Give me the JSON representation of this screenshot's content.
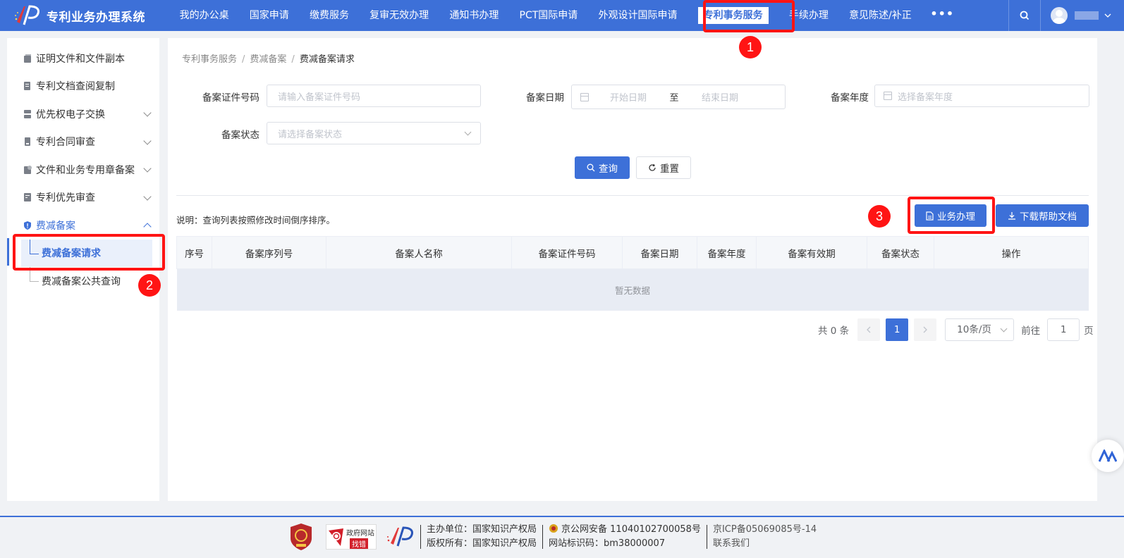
{
  "app": {
    "title": "专利业务办理系统"
  },
  "nav": {
    "items": [
      {
        "label": "我的办公桌"
      },
      {
        "label": "国家申请"
      },
      {
        "label": "缴费服务"
      },
      {
        "label": "复审无效办理"
      },
      {
        "label": "通知书办理"
      },
      {
        "label": "PCT国际申请"
      },
      {
        "label": "外观设计国际申请"
      },
      {
        "label": "专利事务服务",
        "active": true
      },
      {
        "label": "手续办理"
      },
      {
        "label": "意见陈述/补正"
      }
    ],
    "more": "•••"
  },
  "sidebar": {
    "items": [
      {
        "label": "证明文件和文件副本",
        "icon": "document-stack-icon"
      },
      {
        "label": "专利文档查阅复制",
        "icon": "document-copy-icon"
      },
      {
        "label": "优先权电子交换",
        "icon": "server-icon"
      },
      {
        "label": "专利合同审查",
        "icon": "contract-icon"
      },
      {
        "label": "文件和业务专用章备案",
        "icon": "seal-document-icon"
      },
      {
        "label": "专利优先审查",
        "icon": "priority-icon"
      },
      {
        "label": "费减备案",
        "icon": "shield-icon"
      }
    ],
    "subitems": [
      {
        "label": "费减备案请求",
        "active": true
      },
      {
        "label": "费减备案公共查询"
      }
    ]
  },
  "breadcrumb": {
    "l1": "专利事务服务",
    "l2": "费减备案",
    "l3": "费减备案请求",
    "sep": "/"
  },
  "form": {
    "cert_label": "备案证件号码",
    "cert_placeholder": "请输入备案证件号码",
    "date_label": "备案日期",
    "date_start": "开始日期",
    "date_to": "至",
    "date_end": "结束日期",
    "year_label": "备案年度",
    "year_placeholder": "选择备案年度",
    "status_label": "备案状态",
    "status_placeholder": "请选择备案状态",
    "query_btn": "查询",
    "reset_btn": "重置"
  },
  "note": "说明：查询列表按照修改时间倒序排序。",
  "actions": {
    "process_btn": "业务办理",
    "download_btn": "下载帮助文档"
  },
  "table": {
    "columns": [
      "序号",
      "备案序列号",
      "备案人名称",
      "备案证件号码",
      "备案日期",
      "备案年度",
      "备案有效期",
      "备案状态",
      "操作"
    ],
    "empty": "暂无数据"
  },
  "pagination": {
    "total": "共 0 条",
    "current": "1",
    "size": "10条/页",
    "goto_prefix": "前往",
    "goto_value": "1",
    "goto_suffix": "页"
  },
  "annotations": [
    "1",
    "2",
    "3"
  ],
  "footer": {
    "org": "主办单位：国家知识产权局",
    "copyright": "版权所有：国家知识产权局",
    "police": "京公网安备 11040102700058号",
    "site_id": "网站标识码：bm38000007",
    "icp": "京ICP备05069085号-14",
    "contact": "联系我们",
    "gov_logo_top": "政府网站",
    "gov_logo_bottom": "找错"
  },
  "colors": {
    "brand": "#3d70d8",
    "highlight": "#ff1414"
  }
}
